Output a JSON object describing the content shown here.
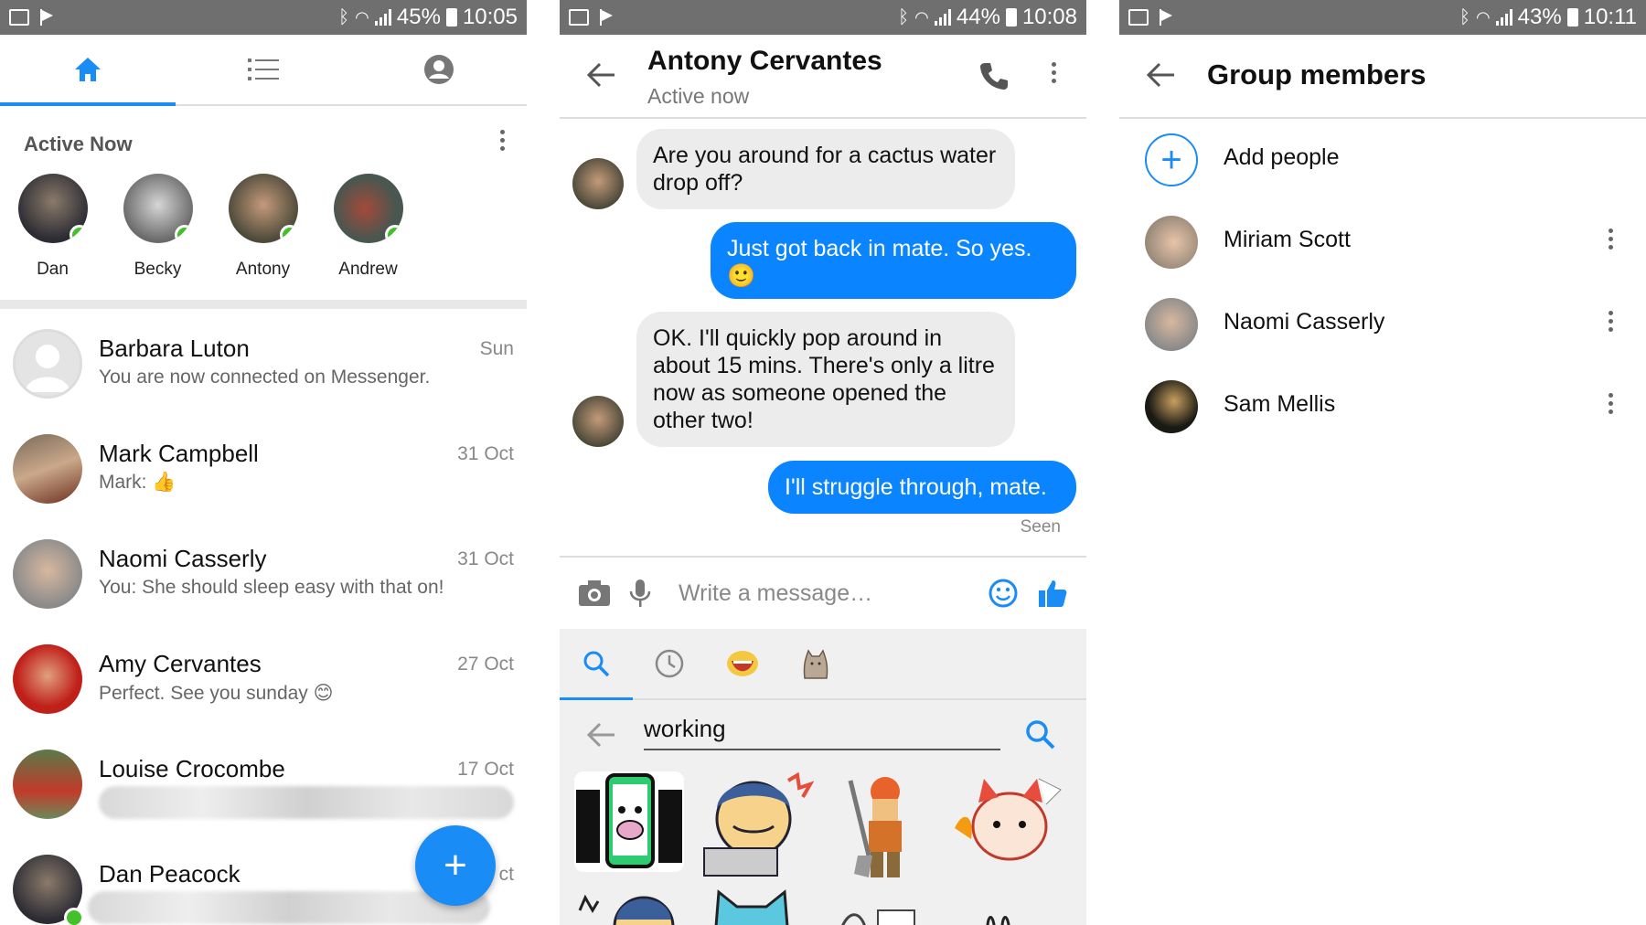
{
  "panels": [
    {
      "statusbar": {
        "battery": "45%",
        "time": "10:05"
      },
      "tabs": [
        {
          "icon": "home-icon",
          "active": true
        },
        {
          "icon": "list-icon",
          "active": false
        },
        {
          "icon": "profile-icon",
          "active": false
        }
      ],
      "active_now": {
        "title": "Active Now",
        "people": [
          {
            "name": "Dan"
          },
          {
            "name": "Becky"
          },
          {
            "name": "Antony"
          },
          {
            "name": "Andrew"
          }
        ]
      },
      "conversations": [
        {
          "name": "Barbara Luton",
          "message": "You are now connected on Messenger.",
          "date": "Sun"
        },
        {
          "name": "Mark Campbell",
          "message": "Mark: 👍",
          "date": "31 Oct"
        },
        {
          "name": "Naomi Casserly",
          "message": "You: She should sleep easy with that on!",
          "date": "31 Oct"
        },
        {
          "name": "Amy Cervantes",
          "message": "Perfect. See you sunday 😊",
          "date": "27 Oct"
        },
        {
          "name": "Louise Crocombe",
          "message": "",
          "date": "17 Oct"
        },
        {
          "name": "Dan Peacock",
          "message": "",
          "date": "ct"
        }
      ],
      "fab_label": "+"
    },
    {
      "statusbar": {
        "battery": "44%",
        "time": "10:08"
      },
      "header": {
        "title": "Antony Cervantes",
        "subtitle": "Active now"
      },
      "messages": [
        {
          "text": "Are you around for a cactus water drop off?",
          "outgoing": false
        },
        {
          "text": "Just got back in mate. So yes. 🙂",
          "outgoing": true
        },
        {
          "text": "OK. I'll quickly pop around in about 15 mins. There's only a litre now as someone opened the other two!",
          "outgoing": false
        },
        {
          "text": "I'll struggle through,  mate.",
          "outgoing": true
        }
      ],
      "seen": "Seen",
      "composer": {
        "placeholder": "Write a message…"
      },
      "sticker_search": {
        "value": "working"
      }
    },
    {
      "statusbar": {
        "battery": "43%",
        "time": "10:11"
      },
      "header": {
        "title": "Group members"
      },
      "add_people": "Add people",
      "members": [
        {
          "name": "Miriam Scott"
        },
        {
          "name": "Naomi Casserly"
        },
        {
          "name": "Sam Mellis"
        }
      ]
    }
  ],
  "colors": {
    "accent": "#1a8cf5",
    "online": "#44c02b",
    "statusbar": "#6f6f6f"
  }
}
